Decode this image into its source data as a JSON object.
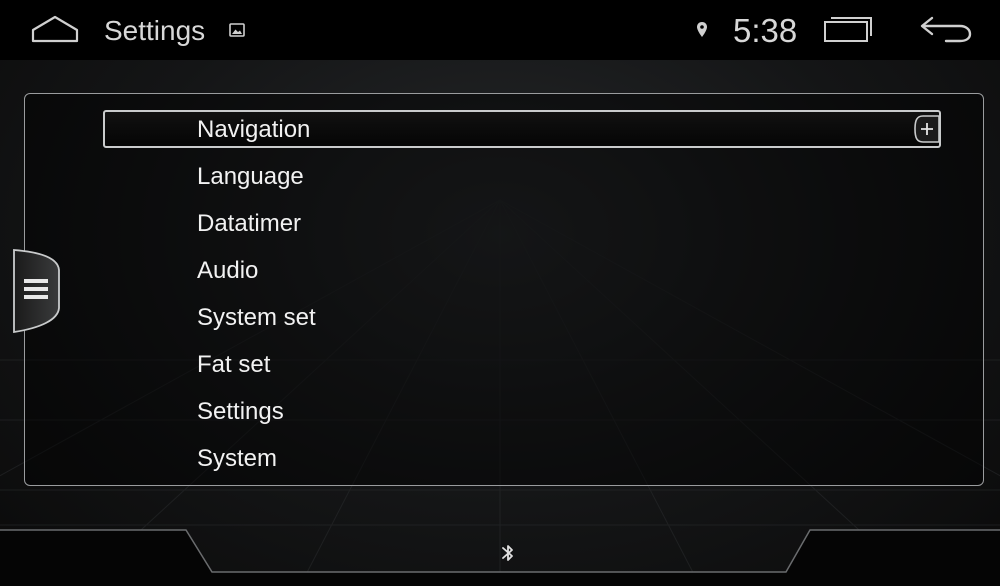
{
  "status_bar": {
    "title": "Settings",
    "time": "5:38",
    "icons": [
      "home-icon",
      "image-icon",
      "location-icon",
      "recents-icon",
      "back-icon"
    ]
  },
  "menu": {
    "selected_index": 0,
    "items": [
      {
        "label": "Navigation"
      },
      {
        "label": "Language"
      },
      {
        "label": "Datatimer"
      },
      {
        "label": "Audio"
      },
      {
        "label": "System set"
      },
      {
        "label": "Fat set"
      },
      {
        "label": "Settings"
      },
      {
        "label": "System"
      }
    ]
  },
  "side_drawer": {
    "icon": "hamburger-menu-icon"
  },
  "bottom_bar": {
    "icon": "bluetooth-icon"
  },
  "colors": {
    "background": "#141516",
    "text": "#f2f2f2",
    "status_text": "#d8d8d8",
    "border": "#9a9c9e"
  }
}
